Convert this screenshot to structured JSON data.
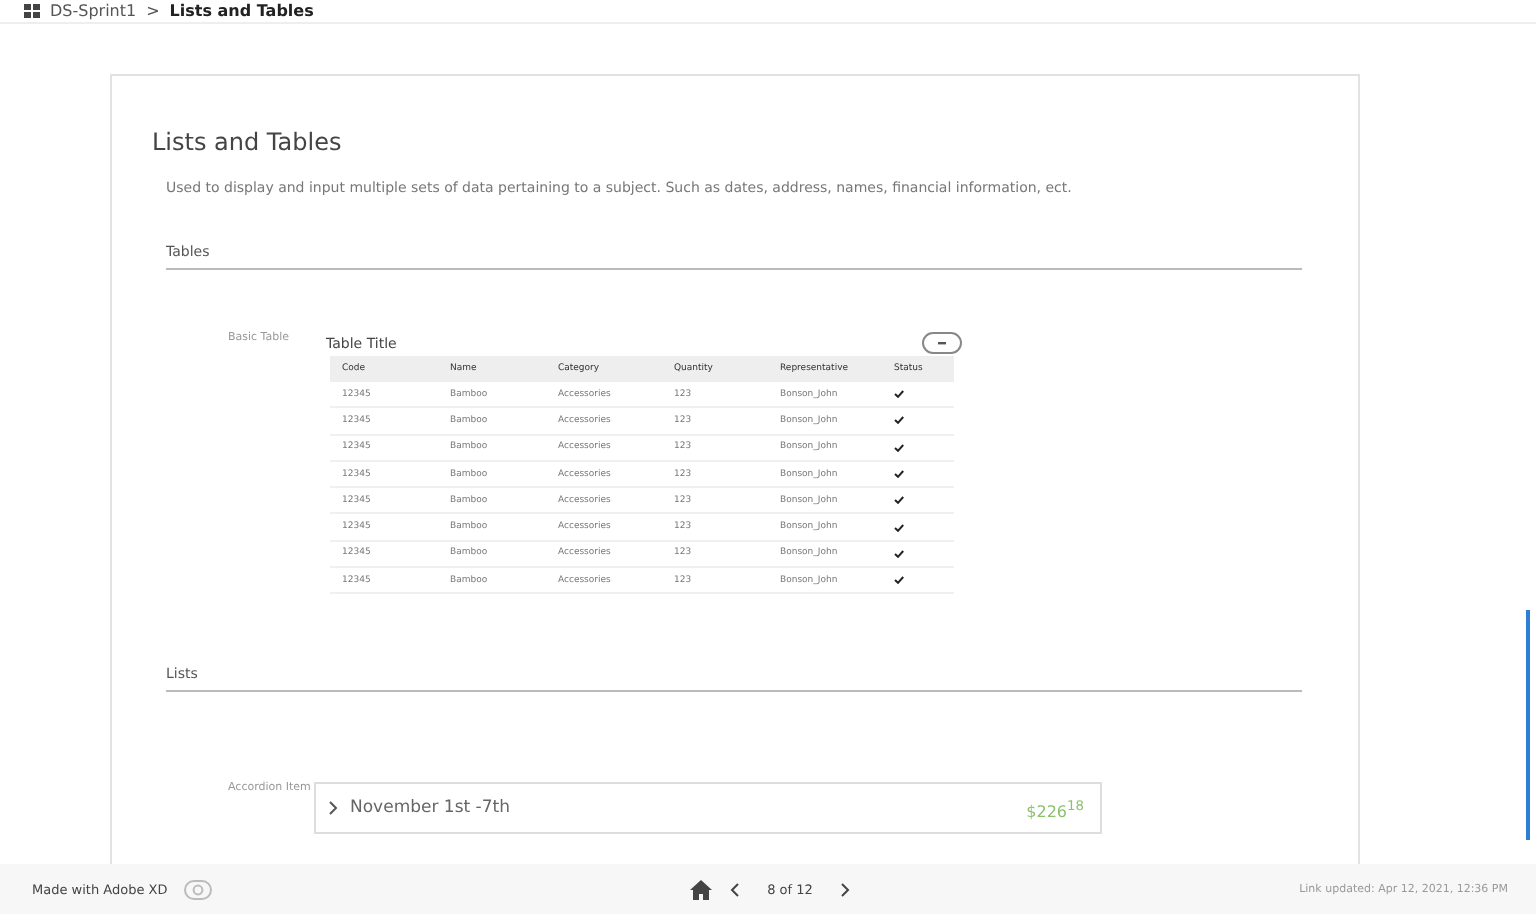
{
  "breadcrumb": {
    "project": "DS-Sprint1",
    "separator": ">",
    "page": "Lists and Tables"
  },
  "title": "Lists and Tables",
  "description": "Used to display and input multiple sets of data pertaining to a subject. Such as dates, address, names, financial information, ect.",
  "sections": [
    {
      "heading": "Tables"
    },
    {
      "heading": "Lists"
    }
  ],
  "basic_table": {
    "label": "Basic Table",
    "title": "Table Title",
    "columns": [
      "Code",
      "Name",
      "Category",
      "Quantity",
      "Representative",
      "Status"
    ],
    "rows": [
      {
        "code": "12345",
        "name": "Bamboo",
        "category": "Accessories",
        "quantity": "123",
        "representative": "Bonson_John",
        "checked": true
      },
      {
        "code": "12345",
        "name": "Bamboo",
        "category": "Accessories",
        "quantity": "123",
        "representative": "Bonson_John",
        "checked": true
      },
      {
        "code": "12345",
        "name": "Bamboo",
        "category": "Accessories",
        "quantity": "123",
        "representative": "Bonson_John",
        "checked": true
      },
      {
        "code": "12345",
        "name": "Bamboo",
        "category": "Accessories",
        "quantity": "123",
        "representative": "Bonson_John",
        "checked": true
      },
      {
        "code": "12345",
        "name": "Bamboo",
        "category": "Accessories",
        "quantity": "123",
        "representative": "Bonson_John",
        "checked": true
      },
      {
        "code": "12345",
        "name": "Bamboo",
        "category": "Accessories",
        "quantity": "123",
        "representative": "Bonson_John",
        "checked": true
      },
      {
        "code": "12345",
        "name": "Bamboo",
        "category": "Accessories",
        "quantity": "123",
        "representative": "Bonson_John",
        "checked": true
      },
      {
        "code": "12345",
        "name": "Bamboo",
        "category": "Accessories",
        "quantity": "123",
        "representative": "Bonson_John",
        "checked": true
      }
    ]
  },
  "accordion": {
    "label": "Accordion Item",
    "title": "November 1st -7th",
    "amount": "$226$^{18}$",
    "expanded": false
  },
  "footer": {
    "made_with": "Made with Adobe XD",
    "page": "8 of 12",
    "updated": "Link updated: Apr 12, 2021, 12:36 PM"
  }
}
